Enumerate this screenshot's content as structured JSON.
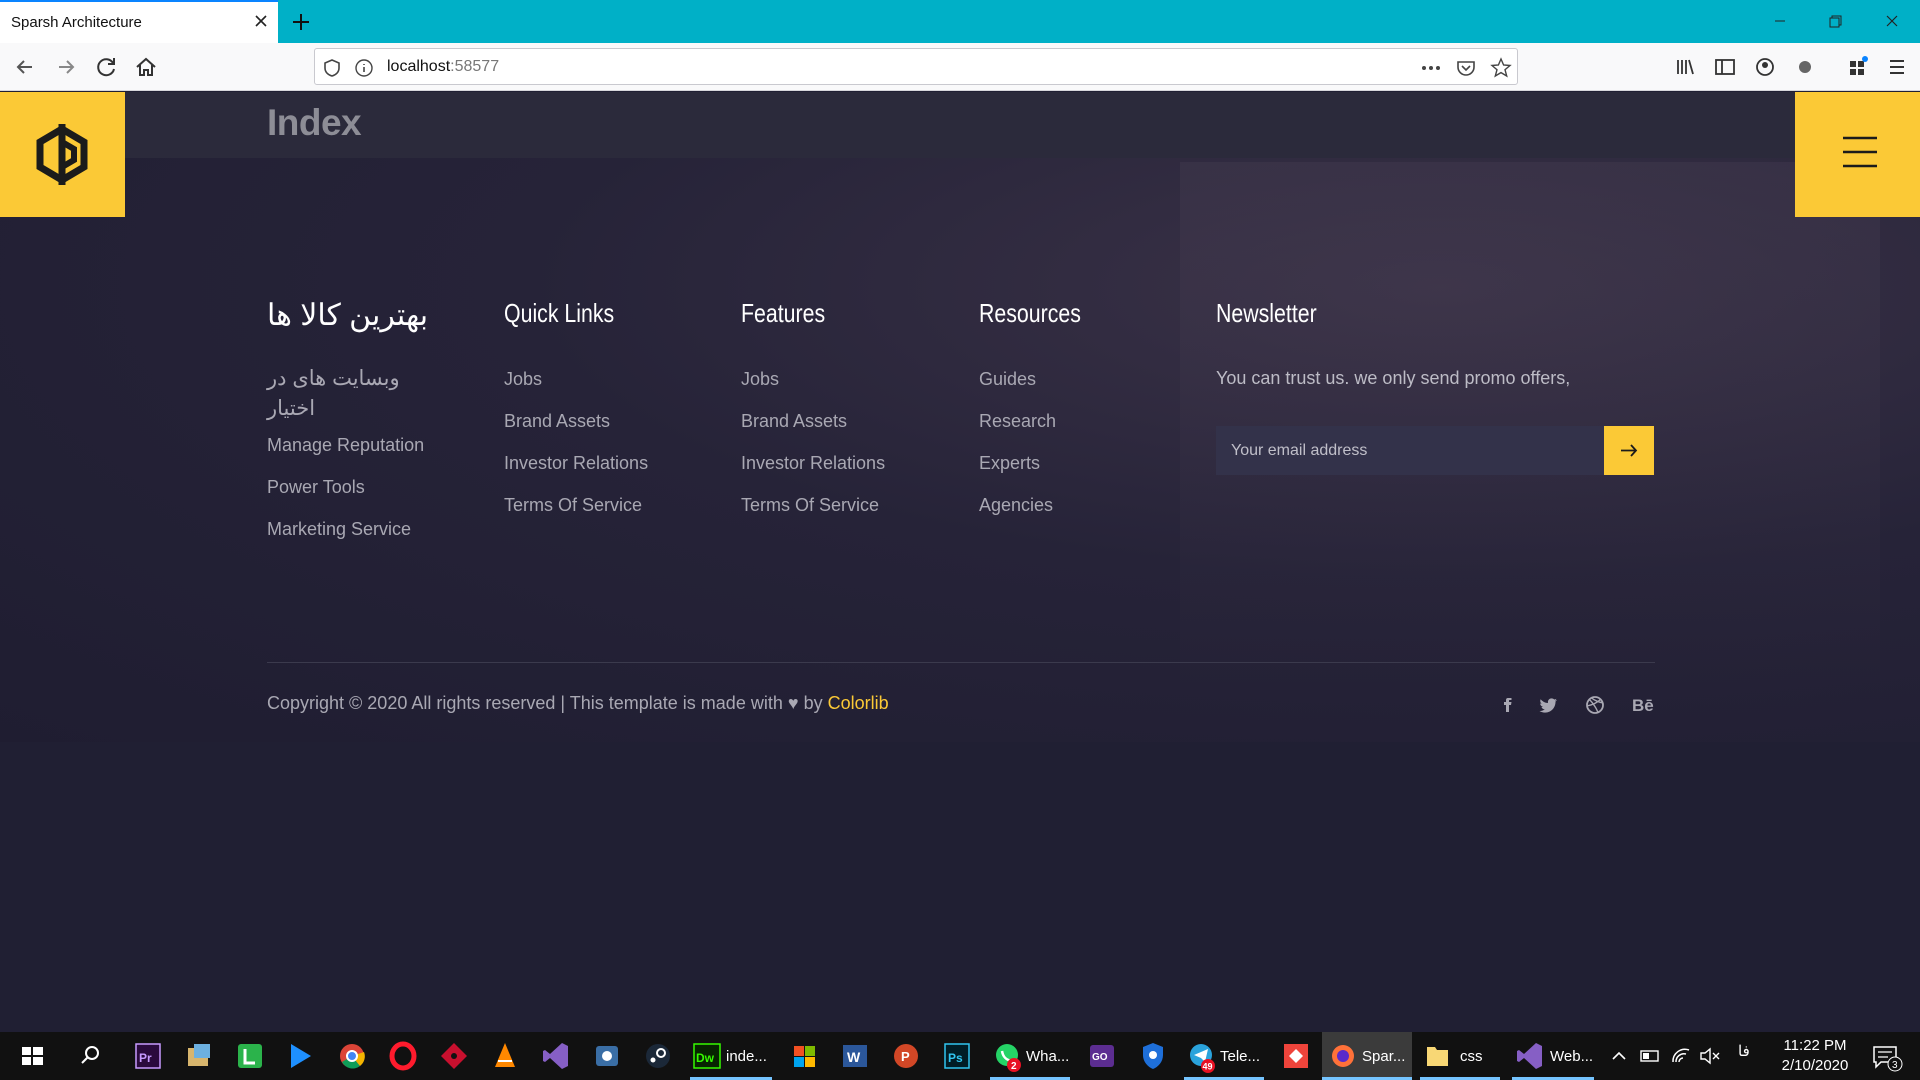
{
  "browser": {
    "tab_title": "Sparsh Architecture",
    "url_host": "localhost",
    "url_port": ":58577"
  },
  "site": {
    "page_heading": "Index",
    "colors": {
      "accent": "#fbc936",
      "background": "#201f33",
      "strip": "#2b2a3b"
    },
    "footer": {
      "brand_col": {
        "title": "بهترین کالا ها",
        "description": "وبسایت های در اختیار",
        "links": [
          "Manage Reputation",
          "Power Tools",
          "Marketing Service"
        ]
      },
      "quick_links": {
        "title": "Quick Links",
        "links": [
          "Jobs",
          "Brand Assets",
          "Investor Relations",
          "Terms Of Service"
        ]
      },
      "features": {
        "title": "Features",
        "links": [
          "Jobs",
          "Brand Assets",
          "Investor Relations",
          "Terms Of Service"
        ]
      },
      "resources": {
        "title": "Resources",
        "links": [
          "Guides",
          "Research",
          "Experts",
          "Agencies"
        ]
      },
      "newsletter": {
        "title": "Newsletter",
        "text": "You can trust us. we only send promo offers,",
        "email_placeholder": "Your email address"
      },
      "copyright_prefix": "Copyright © 2020 All rights reserved | This template is made with",
      "copyright_by": "by",
      "copyright_brand": "Colorlib",
      "social_icons": [
        "facebook-icon",
        "twitter-icon",
        "dribbble-icon",
        "behance-icon"
      ]
    }
  },
  "taskbar": {
    "labels": {
      "dreamweaver": "inde...",
      "whatsapp": "Wha...",
      "telegram": "Tele...",
      "firefox": "Spar...",
      "folder": "css",
      "visual_studio": "Web..."
    },
    "whatsapp_badge": "2",
    "telegram_badge": "49",
    "language": "فا",
    "time": "11:22 PM",
    "date": "2/10/2020",
    "notification_count": "3"
  }
}
